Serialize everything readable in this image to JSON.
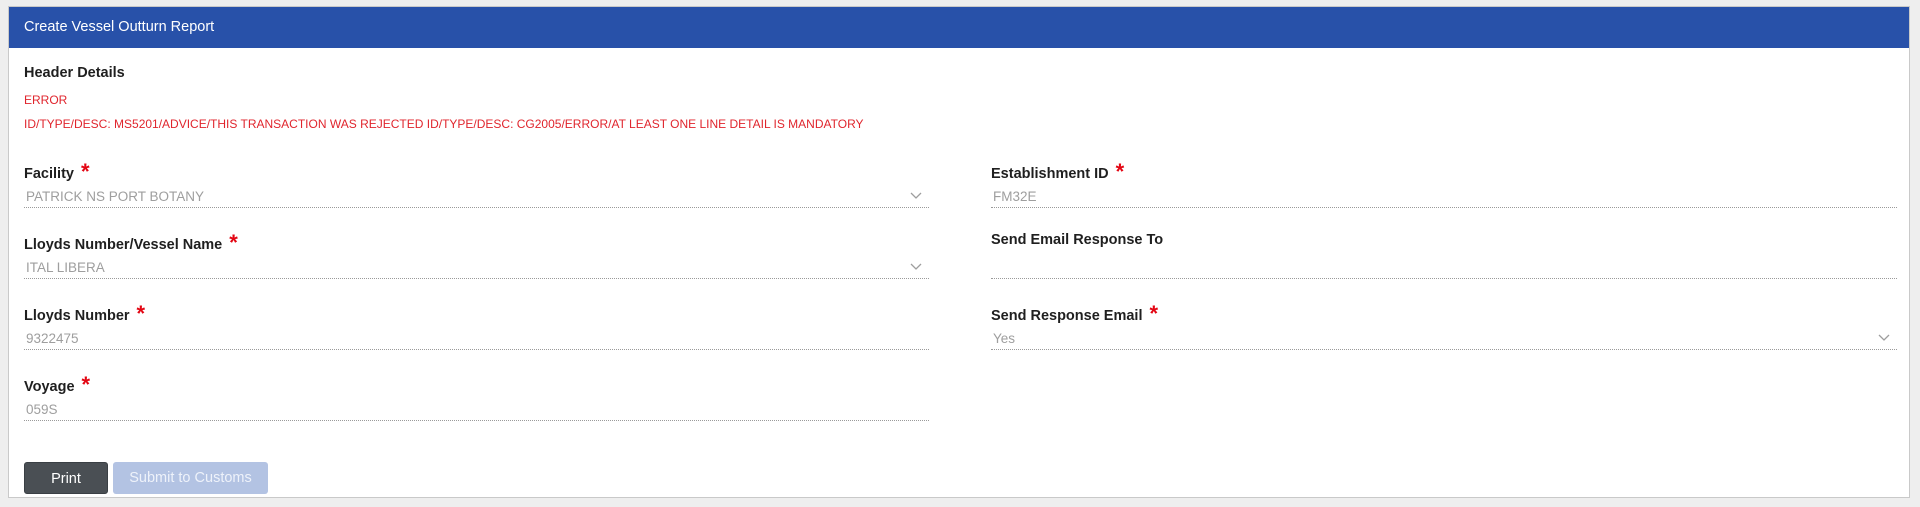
{
  "panel": {
    "title": "Create Vessel Outturn Report"
  },
  "header_details": {
    "title": "Header Details",
    "error_label": "ERROR",
    "error_message": "ID/TYPE/DESC: MS5201/ADVICE/THIS TRANSACTION WAS REJECTED ID/TYPE/DESC: CG2005/ERROR/AT LEAST ONE LINE DETAIL IS MANDATORY"
  },
  "fields": {
    "facility": {
      "label": "Facility",
      "value": "PATRICK NS PORT BOTANY"
    },
    "vessel_name": {
      "label": "Lloyds Number/Vessel Name",
      "value": "ITAL LIBERA"
    },
    "lloyds_number": {
      "label": "Lloyds Number",
      "value": "9322475"
    },
    "voyage": {
      "label": "Voyage",
      "value": "059S"
    },
    "establishment_id": {
      "label": "Establishment ID",
      "value": "FM32E"
    },
    "send_email_to": {
      "label": "Send Email Response To",
      "value": ""
    },
    "send_response_email": {
      "label": "Send Response Email",
      "value": "Yes"
    }
  },
  "required_marker": "*",
  "buttons": {
    "print": "Print",
    "submit": "Submit to Customs"
  },
  "colors": {
    "header_bg": "#2851a9",
    "error": "#e0252d",
    "required": "#e30613"
  }
}
